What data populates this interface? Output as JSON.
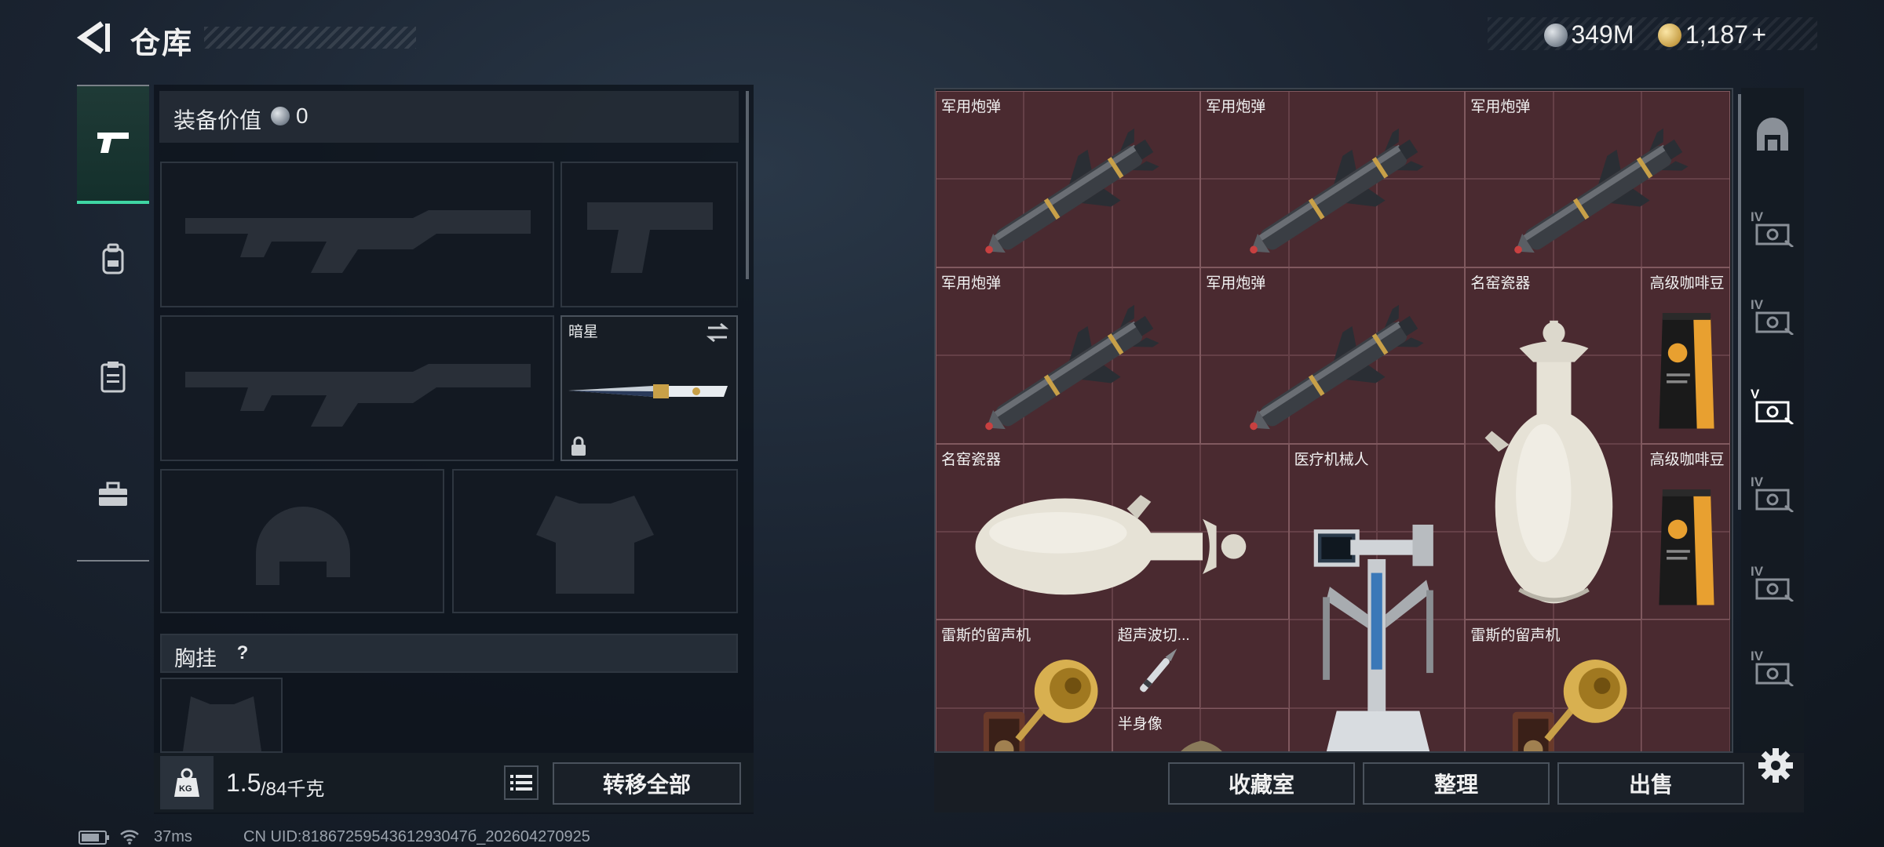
{
  "header": {
    "title": "仓库"
  },
  "currency": {
    "silver": "349M",
    "gold": "1,187",
    "gold_plus": "+"
  },
  "left_tabs": [
    {
      "name": "weapons",
      "icon": "pistol-icon",
      "active": true
    },
    {
      "name": "backpack",
      "icon": "backpack-icon"
    },
    {
      "name": "clipboard",
      "icon": "clipboard-icon"
    },
    {
      "name": "toolbox",
      "icon": "toolbox-icon"
    }
  ],
  "equipment": {
    "value_label": "装备价值",
    "value": "0",
    "melee_name": "暗星",
    "chest_rig_label": "胸挂",
    "help": "?",
    "weight_current": "1.5",
    "weight_max": "/84千克",
    "weight_badge": "KG",
    "transfer_all": "转移全部"
  },
  "stash_items": [
    {
      "label": "军用炮弹"
    },
    {
      "label": "军用炮弹"
    },
    {
      "label": "军用炮弹"
    },
    {
      "label": "军用炮弹"
    },
    {
      "label": "军用炮弹"
    },
    {
      "label": "名窑瓷器"
    },
    {
      "label": "高级咖啡豆"
    },
    {
      "label": "名窑瓷器"
    },
    {
      "label": "医疗机械人"
    },
    {
      "label": "高级咖啡豆"
    },
    {
      "label": "雷斯的留声机"
    },
    {
      "label": "超声波切..."
    },
    {
      "label": "雷斯的留声机"
    },
    {
      "label": "半身像"
    }
  ],
  "stash_buttons": {
    "collection": "收藏室",
    "sort": "整理",
    "sell": "出售"
  },
  "right_tabs": [
    {
      "icon": "storage-arch-icon"
    },
    {
      "icon": "stash-tier-iv-icon",
      "tier": "IV"
    },
    {
      "icon": "stash-tier-iv-icon",
      "tier": "IV"
    },
    {
      "icon": "stash-tier-v-icon",
      "tier": "V"
    },
    {
      "icon": "medical-tier-iv-icon",
      "tier": "IV"
    },
    {
      "icon": "workbench-tier-iv-icon",
      "tier": "IV"
    },
    {
      "icon": "tier-iv-icon",
      "tier": "IV"
    }
  ],
  "footer": {
    "ping": "37ms",
    "uid": "CN UID:8186725954361293047б_202604270925"
  },
  "colors": {
    "accent": "#3fd6a4",
    "stash_bg": "#4a2a30"
  }
}
